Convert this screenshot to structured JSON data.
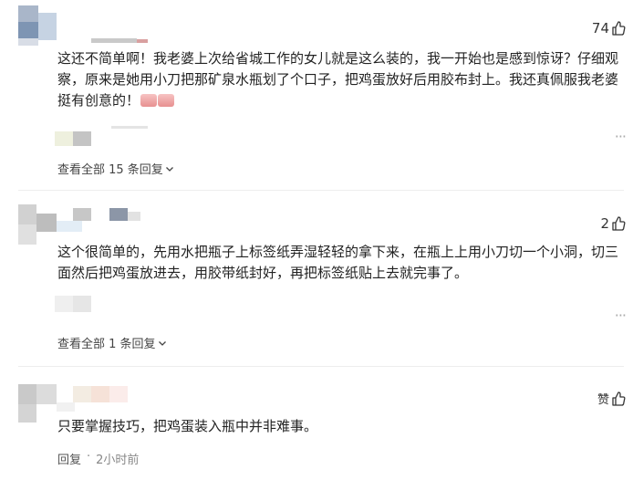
{
  "comments": [
    {
      "likes": "74",
      "text": "这还不简单啊！我老婆上次给省城工作的女儿就是这么装的，我一开始也是感到惊讶？仔细观察，原来是她用小刀把那矿泉水瓶划了个口子，把鸡蛋放好后用胶布封上。我还真佩服我老婆挺有创意的！",
      "emoji": [
        "clapping-hands-emoji",
        "clapping-hands-emoji"
      ],
      "replies_label": "查看全部 15 条回复",
      "more_label": "···"
    },
    {
      "likes": "2",
      "text": "这个很简单的，先用水把瓶子上标签纸弄湿轻轻的拿下来，在瓶上上用小刀切一个小洞，切三面然后把鸡蛋放进去，用胶带纸封好，再把标签纸贴上去就完事了。",
      "replies_label": "查看全部 1 条回复",
      "more_label": "···"
    },
    {
      "likes": "赞",
      "text": "只要掌握技巧，把鸡蛋装入瓶中并非难事。",
      "reply_label": "回复",
      "separator": "·",
      "time": "2小时前"
    }
  ],
  "icons": {
    "like": "thumbs-up-icon",
    "expand": "chevron-down-icon",
    "more": "more-icon"
  }
}
